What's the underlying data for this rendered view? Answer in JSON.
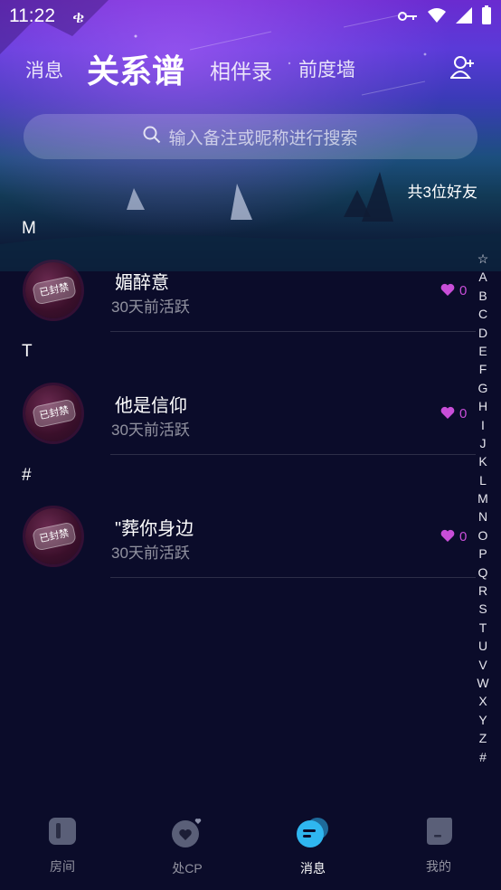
{
  "status_bar": {
    "time": "11:22"
  },
  "tabs": [
    {
      "label": "消息"
    },
    {
      "label": "关系谱"
    },
    {
      "label": "相伴录"
    },
    {
      "label": "前度墙"
    }
  ],
  "search": {
    "placeholder": "输入备注或昵称进行搜索"
  },
  "friend_count": "共3位好友",
  "sections": [
    {
      "letter": "M",
      "friends": [
        {
          "name": "媚醉意",
          "activity": "30天前活跃",
          "likes": "0",
          "badge": "已封禁"
        }
      ]
    },
    {
      "letter": "T",
      "friends": [
        {
          "name": "他是信仰",
          "activity": "30天前活跃",
          "likes": "0",
          "badge": "已封禁"
        }
      ]
    },
    {
      "letter": "#",
      "friends": [
        {
          "name": "\"葬你身边",
          "activity": "30天前活跃",
          "likes": "0",
          "badge": "已封禁"
        }
      ]
    }
  ],
  "index_letters": [
    "☆",
    "A",
    "B",
    "C",
    "D",
    "E",
    "F",
    "G",
    "H",
    "I",
    "J",
    "K",
    "L",
    "M",
    "N",
    "O",
    "P",
    "Q",
    "R",
    "S",
    "T",
    "U",
    "V",
    "W",
    "X",
    "Y",
    "Z",
    "#"
  ],
  "bottom_nav": [
    {
      "label": "房间",
      "icon": "room-icon",
      "active": false
    },
    {
      "label": "处CP",
      "icon": "heart-cp-icon",
      "active": false
    },
    {
      "label": "消息",
      "icon": "message-icon",
      "active": true
    },
    {
      "label": "我的",
      "icon": "profile-icon",
      "active": false
    }
  ],
  "colors": {
    "accent": "#c84ed8",
    "background": "#0b0c2a",
    "active_nav": "#2fb6f0"
  }
}
